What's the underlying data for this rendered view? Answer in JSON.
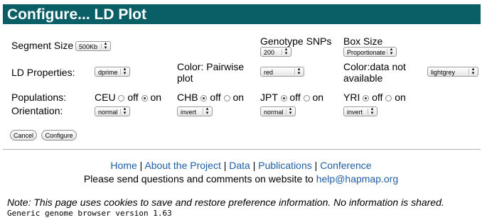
{
  "header": {
    "title": "Configure... LD Plot"
  },
  "row1": {
    "segment_label": "Segment Size",
    "segment_value": "500Kb",
    "genotype_label": "Genotype SNPs",
    "genotype_value": "200",
    "box_label": "Box Size",
    "box_value": "Proportionate"
  },
  "row2": {
    "ld_label": "LD Properties:",
    "ld_value": "dprime",
    "color_pairwise_label_1": "Color: Pairwise",
    "color_pairwise_label_2": "plot",
    "color_pairwise_value": "red",
    "color_na_label_1": "Color:data not",
    "color_na_label_2": "available",
    "color_na_value": "lightgrey"
  },
  "populations": {
    "label": "Populations:",
    "orientation_label": "Orientation:",
    "off_text": "off",
    "on_text": "on",
    "items": [
      {
        "name": "CEU",
        "selected": "on",
        "orientation": "normal"
      },
      {
        "name": "CHB",
        "selected": "off",
        "orientation": "invert"
      },
      {
        "name": "JPT",
        "selected": "off",
        "orientation": "normal"
      },
      {
        "name": "YRI",
        "selected": "off",
        "orientation": "invert"
      }
    ]
  },
  "buttons": {
    "cancel": "Cancel",
    "configure": "Configure"
  },
  "footer": {
    "links": [
      "Home",
      "About the Project",
      "Data",
      "Publications",
      "Conference"
    ],
    "contact_text": "Please send questions and comments on website to ",
    "contact_email": "help@hapmap.org",
    "note": "Note: This page uses cookies to save and restore preference information. No information is shared.",
    "version": "Generic genome browser version 1.63"
  }
}
